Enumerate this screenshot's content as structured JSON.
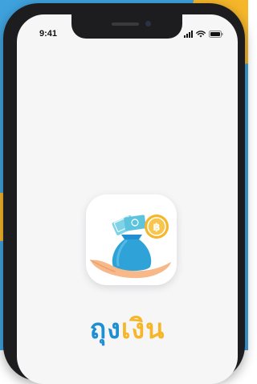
{
  "status_bar": {
    "time": "9:41",
    "signal_icon": "cellular-signal-icon",
    "wifi_icon": "wifi-icon",
    "battery_icon": "battery-icon"
  },
  "app_icon": {
    "icon": "money-bag-on-hand-icon",
    "coin_symbol": "฿"
  },
  "app_name": {
    "part1": "ถุง",
    "part2": "เงิน"
  },
  "colors": {
    "background": "#3fa2dd",
    "accent_yellow": "#f5b62a",
    "brand_blue": "#1f8fd2",
    "screen": "#f6f6f7"
  }
}
